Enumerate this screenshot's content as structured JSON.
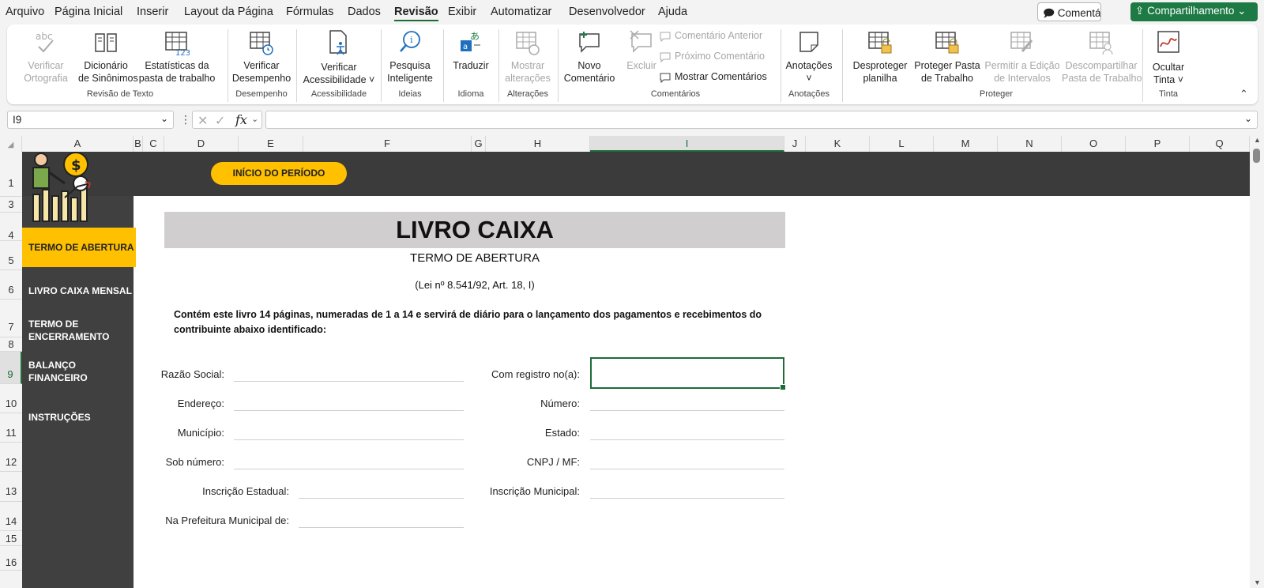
{
  "menu": {
    "tabs": [
      "Arquivo",
      "Página Inicial",
      "Inserir",
      "Layout da Página",
      "Fórmulas",
      "Dados",
      "Revisão",
      "Exibir",
      "Automatizar",
      "Desenvolvedor",
      "Ajuda"
    ],
    "active_tab": "Revisão",
    "comments_button": "Comentários",
    "share_button": "Compartilhamento"
  },
  "ribbon": {
    "spelling_1": "Verificar",
    "spelling_2": "Ortografia",
    "thesaurus_1": "Dicionário",
    "thesaurus_2": "de Sinônimos",
    "stats_1": "Estatísticas da",
    "stats_2": "pasta de trabalho",
    "group_proofing": "Revisão de Texto",
    "perf_1": "Verificar",
    "perf_2": "Desempenho",
    "group_performance": "Desempenho",
    "access_1": "Verificar",
    "access_2": "Acessibilidade",
    "group_accessibility": "Acessibilidade",
    "smart_1": "Pesquisa",
    "smart_2": "Inteligente",
    "group_ideas": "Ideias",
    "translate": "Traduzir",
    "group_language": "Idioma",
    "changes_1": "Mostrar",
    "changes_2": "alterações",
    "group_changes": "Alterações",
    "newc_1": "Novo",
    "newc_2": "Comentário",
    "delete": "Excluir",
    "prev_comment": "Comentário Anterior",
    "next_comment": "Próximo Comentário",
    "show_comments": "Mostrar Comentários",
    "group_comments": "Comentários",
    "notes": "Anotações",
    "group_notes": "Anotações",
    "unprot_1": "Desproteger",
    "unprot_2": "planilha",
    "protwb_1": "Proteger Pasta",
    "protwb_2": "de Trabalho",
    "allow_1": "Permitir a Edição",
    "allow_2": "de Intervalos",
    "unshare_1": "Descompartilhar",
    "unshare_2": "Pasta de Trabalho",
    "group_protect": "Proteger",
    "hideink_1": "Ocultar",
    "hideink_2": "Tinta",
    "group_ink": "Tinta"
  },
  "namebox": "I9",
  "columns": [
    "A",
    "B",
    "C",
    "D",
    "E",
    "F",
    "G",
    "H",
    "I",
    "J",
    "K",
    "L",
    "M",
    "N",
    "O",
    "P",
    "Q"
  ],
  "rows": [
    "1",
    "3",
    "4",
    "5",
    "6",
    "7",
    "8",
    "9",
    "10",
    "11",
    "12",
    "13",
    "14",
    "15",
    "16"
  ],
  "sheet": {
    "start_button": "INÍCIO DO PERÍODO",
    "nav": [
      "TERMO DE ABERTURA",
      "LIVRO CAIXA MENSAL",
      "TERMO DE",
      "ENCERRAMENTO",
      "BALANÇO",
      "FINANCEIRO",
      "INSTRUÇÕES"
    ],
    "title": "LIVRO CAIXA",
    "subtitle": "TERMO DE ABERTURA",
    "law": "(Lei nº 8.541/92, Art. 18, I)",
    "intro": "Contém este livro 14 páginas, numeradas de 1 a 14 e servirá de diário para o lançamento dos pagamentos e recebimentos do contribuinte abaixo identificado:",
    "labels_left": [
      "Razão Social:",
      "Endereço:",
      "Município:",
      "Sob número:",
      "Inscrição Estadual:",
      "Na Prefeitura Municipal de:"
    ],
    "labels_right": [
      "Com registro no(a):",
      "Número:",
      "Estado:",
      "CNPJ / MF:",
      "Inscrição Municipal:"
    ]
  }
}
